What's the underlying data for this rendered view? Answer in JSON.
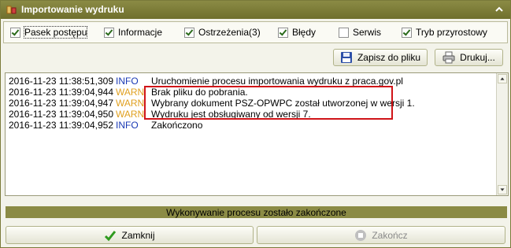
{
  "window": {
    "title": "Importowanie wydruku",
    "app_icon": "import-icon",
    "collapse_icon": "chevron-up-icon"
  },
  "options": [
    {
      "label": "Pasek postępu",
      "checked": true
    },
    {
      "label": "Informacje",
      "checked": true
    },
    {
      "label": "Ostrzeżenia(3)",
      "checked": true
    },
    {
      "label": "Błędy",
      "checked": true
    },
    {
      "label": "Serwis",
      "checked": false
    },
    {
      "label": "Tryb przyrostowy",
      "checked": true
    }
  ],
  "toolbar": {
    "save_label": "Zapisz do pliku",
    "save_icon": "floppy-icon",
    "print_label": "Drukuj...",
    "print_icon": "printer-icon"
  },
  "log": {
    "rows": [
      {
        "timestamp": "2016-11-23 11:38:51,309",
        "level": "INFO",
        "message": "Uruchomienie procesu importowania wydruku z praca.gov.pl"
      },
      {
        "timestamp": "2016-11-23 11:39:04,944",
        "level": "WARN",
        "message": "Brak pliku do pobrania."
      },
      {
        "timestamp": "2016-11-23 11:39:04,947",
        "level": "WARN",
        "message": "Wybrany dokument PSZ-OPWPC został utworzonej w wersji 1."
      },
      {
        "timestamp": "2016-11-23 11:39:04,950",
        "level": "WARN",
        "message": "Wydruku jest obsługiwany od wersji 7."
      },
      {
        "timestamp": "2016-11-23 11:39:04,952",
        "level": "INFO",
        "message": "Zakończono"
      }
    ]
  },
  "colors": {
    "info": "#1a39b4",
    "warn": "#e0a020",
    "highlight": "#d01418",
    "titlebar": "#7d7d38"
  },
  "status": {
    "text": "Wykonywanie procesu zostało zakończone"
  },
  "footer": {
    "close_label": "Zamknij",
    "close_icon": "checkmark-icon",
    "finish_label": "Zakończ",
    "finish_icon": "stop-icon",
    "finish_enabled": false
  }
}
